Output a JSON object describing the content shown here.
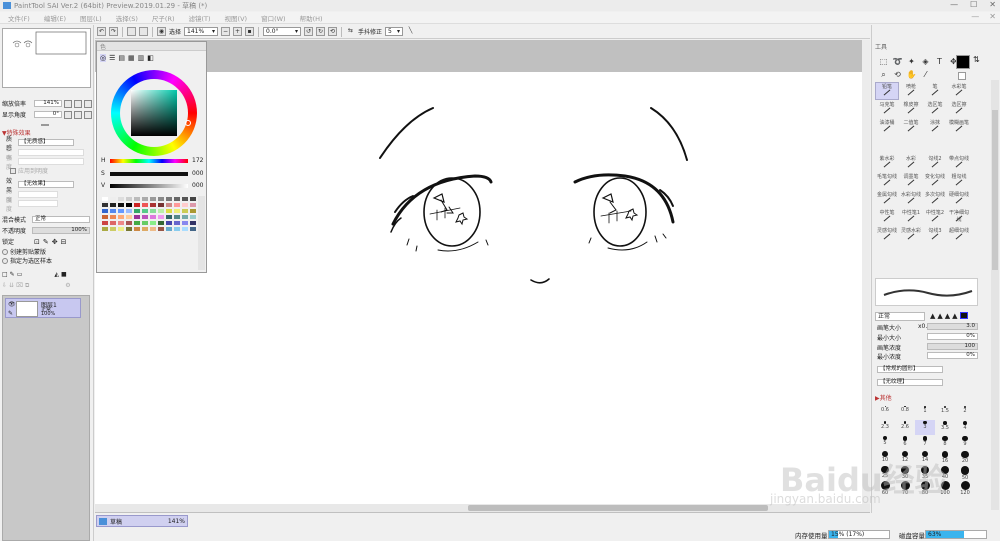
{
  "window": {
    "title": "PaintTool SAI Ver.2 (64bit) Preview.2019.01.29 - 草稿 (*)"
  },
  "menu": [
    "文件(F)",
    "编辑(E)",
    "图层(L)",
    "选择(S)",
    "尺子(R)",
    "滤镜(T)",
    "视图(V)",
    "窗口(W)",
    "帮助(H)"
  ],
  "toolbar": {
    "select_label": "选择",
    "zoom": "141%",
    "angle": "0.0°",
    "stabilizer_label": "手抖修正",
    "stabilizer_value": "5"
  },
  "left": {
    "zoom_label": "缩放倍率",
    "zoom_value": "141%",
    "angle_label": "显示角度",
    "angle_value": "0°",
    "effects_header": "▼特殊效果",
    "paper_label": "质感",
    "paper_value": "【无质感】",
    "scale_label": "倍率",
    "strength_label": "强度",
    "brightness_label": "应用到明度",
    "effect_label": "效果",
    "effect_value": "【无效果】",
    "width_label": "宽度",
    "effect_strength_label": "强度",
    "blend_label": "混合模式",
    "blend_value": "正常",
    "opacity_label": "不透明度",
    "opacity_value": "100%",
    "lock_label": "锁定",
    "clip_label": "创建剪贴蒙版",
    "ref_label": "指定为选区样本",
    "layer_name": "图层1",
    "layer_mode": "正常",
    "layer_opacity": "100%"
  },
  "color": {
    "title": "色",
    "h_label": "H",
    "h_value": "172",
    "s_label": "S",
    "s_value": "000",
    "v_label": "V",
    "v_value": "000"
  },
  "right": {
    "tools_title": "工具",
    "brushes": [
      "铅笔",
      "喷枪",
      "笔",
      "水彩笔",
      "马克笔",
      "橡皮擦",
      "选区笔",
      "选区擦",
      "油漆桶",
      "二值笔",
      "涂抹",
      "模糊画笔",
      "",
      "",
      "",
      "",
      "紫水彩",
      "水彩",
      "勾线2",
      "带点勾线",
      "毛笔勾线",
      "调墨笔",
      "变化勾线",
      "粗勾线",
      "金属勾线",
      "水彩勾线",
      "多次勾线",
      "硬细勾线",
      "中性笔",
      "中性笔1",
      "中性笔2",
      "干净细勾线",
      "灵感勾线",
      "灵感水彩",
      "勾线3",
      "超细勾线"
    ],
    "blend_mode": "正常",
    "size_label": "画笔大小",
    "size_mult": "x0.1",
    "size_value": "3.0",
    "minsize_label": "最小大小",
    "minsize_value": "0%",
    "density_label": "画笔浓度",
    "density_value": "100",
    "mindens_label": "最小浓度",
    "mindens_value": "0%",
    "shape_value": "【常规的圆形】",
    "texture_value": "【无纹理】",
    "other_label": "▶其他",
    "sizes": [
      "0.6",
      "0.8",
      "1",
      "1.5",
      "2",
      "2.3",
      "2.6",
      "3",
      "3.5",
      "4",
      "5",
      "6",
      "7",
      "8",
      "9",
      "10",
      "12",
      "14",
      "16",
      "20",
      "25",
      "30",
      "35",
      "40",
      "50",
      "60",
      "70",
      "80",
      "100",
      "120"
    ]
  },
  "status": {
    "doc_name": "草稿",
    "doc_zoom": "141%",
    "mem_label": "内存使用量",
    "mem_value": "15% (17%)",
    "mem_fraction": 0.15,
    "disk_label": "磁盘容量",
    "disk_value": "63%",
    "disk_fraction": 0.63
  },
  "watermark": {
    "text": "Baidu经验",
    "url": "jingyan.baidu.com"
  }
}
